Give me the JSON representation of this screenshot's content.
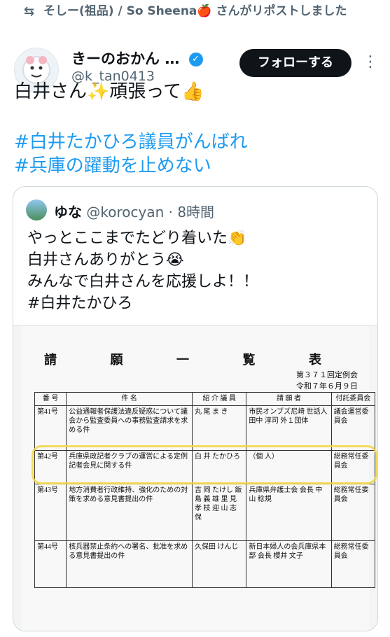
{
  "repost": {
    "icon": "repost-icon",
    "text": "そしー(祖品) / So Sheena🍎 さんがリポストしました"
  },
  "author": {
    "name": "きーのおかん",
    "name_ellipsis": "…",
    "handle": "@k_tan0413",
    "verified_icon": "verified-badge-icon",
    "follow_label": "フォローする",
    "more_icon": "more-options-icon"
  },
  "tweet": {
    "text": "白井さん✨頑張って👍",
    "hashtags": [
      "#白井たかひろ議員がんばれ",
      "#兵庫の躍動を止めない"
    ]
  },
  "quote": {
    "name": "ゆな",
    "handle": "@korocyan",
    "time": "· 8時間",
    "lines": [
      "やっとここまでたどり着いた👏",
      "白井さんありがとう😭",
      "みんなで白井さんを応援しよ！！",
      "#白井たかひろ"
    ]
  },
  "document": {
    "title": "請 願 一 覧 表",
    "session": "第３７１回定例会",
    "date": "令和７年６月９日",
    "columns": [
      "番 号",
      "件 名",
      "紹 介 議 員",
      "請 願 者",
      "付託委員会"
    ],
    "rows": [
      {
        "number": "第41号",
        "subject": "公益通報者保護法違反疑惑について議会から監査委員への事務監査請求を求める件",
        "introducer": "丸 尾 ま き",
        "petitioner": "市民オンブズ尼崎 世話人 田中 淳司 外１団体",
        "committee": "議会運営委員会"
      },
      {
        "number": "第42号",
        "subject": "兵庫県政記者クラブの運営による定例記者会見に関する件",
        "introducer": "白 井 たかひろ",
        "petitioner": "（個 人）",
        "committee": "総務常任委員会"
      },
      {
        "number": "第43号",
        "subject": "地方消費者行政維持、強化のための対策を求める意見書提出の件",
        "introducer": "吉 岡 たけし 飯 島 義 雄 里 見 孝 枝 迎 山 志 保",
        "petitioner": "兵庫県弁護士会 会長 中山 稔規",
        "committee": "総務常任委員会"
      },
      {
        "number": "第44号",
        "subject": "核兵器禁止条約への署名、批准を求める意見書提出の件",
        "introducer": "久保田 けんじ",
        "petitioner": "新日本婦人の会兵庫県本部 会長 櫻井 文子",
        "committee": "総務常任委員会"
      }
    ]
  }
}
